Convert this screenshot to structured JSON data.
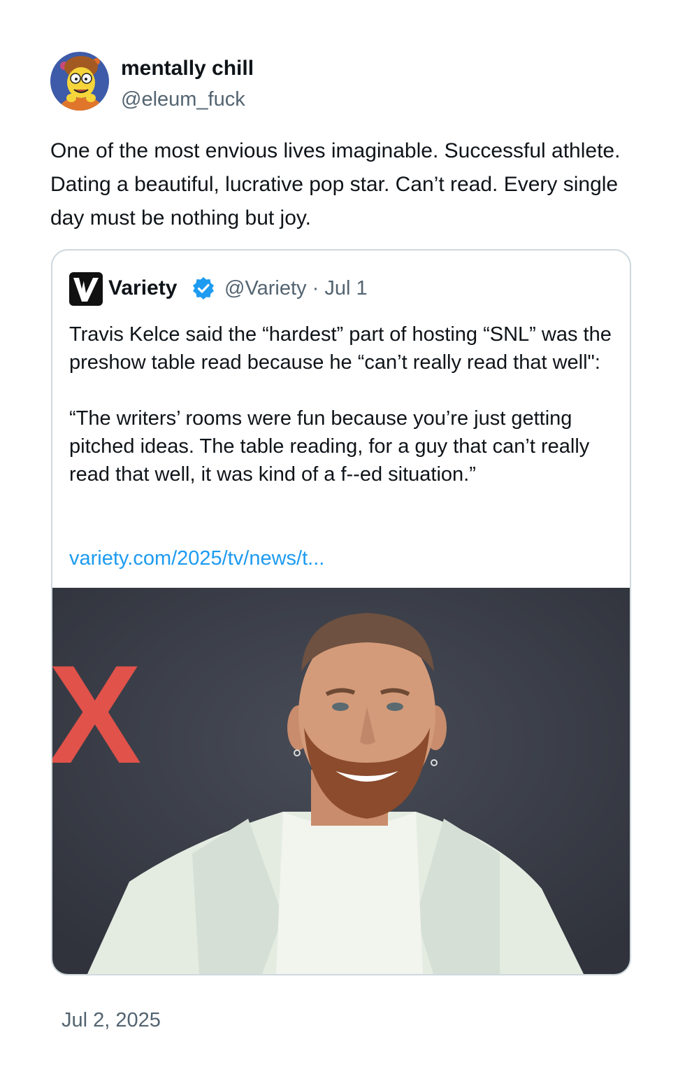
{
  "author": {
    "display_name": "mentally chill",
    "handle": "@eleum_fuck",
    "avatar_icon": "cartoon-character-avatar"
  },
  "tweet": {
    "text": "One of the most envious lives imaginable. Successful athlete. Dating a beautiful, lucrative pop star. Can’t read. Every single day must be nothing but joy.",
    "date": "Jul 2, 2025"
  },
  "quoted_tweet": {
    "name": "Variety",
    "logo_icon": "variety-logo-icon",
    "verified_icon": "verified-badge-icon",
    "handle": "@Variety",
    "separator": "·",
    "date": "Jul 1",
    "paragraph_1": "Travis Kelce said the “hardest” part of hosting “SNL” was the preshow table read because he “can’t really read that well\":",
    "paragraph_2": "“The writers’ rooms were fun because you’re just getting pitched ideas. The table reading, for a guy that can’t really read that well, it was kind of a f--ed situation.”",
    "link": "variety.com/2025/tv/news/t...",
    "image_backdrop_letter": "X"
  },
  "colors": {
    "text": "#0f1419",
    "secondary": "#536471",
    "link": "#1d9bf0",
    "border": "#cfd9de",
    "verified": "#1d9bf0",
    "backdrop": "#3a3e49",
    "backdrop_letter": "#e0524a",
    "jacket": "#e4ece2"
  }
}
